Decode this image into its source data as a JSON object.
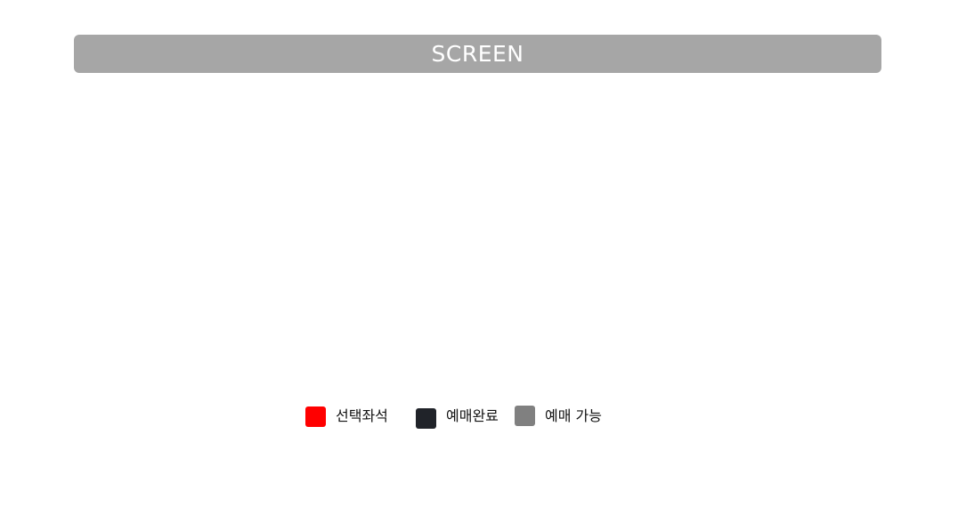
{
  "screen": {
    "label": "SCREEN",
    "background_color": "#a6a6a6",
    "text_color": "#ffffff"
  },
  "legend": {
    "items": [
      {
        "label": "선택좌석",
        "color": "#ff0000"
      },
      {
        "label": "예매완료",
        "color": "#202329"
      },
      {
        "label": "예매 가능",
        "color": "#808080"
      }
    ]
  }
}
